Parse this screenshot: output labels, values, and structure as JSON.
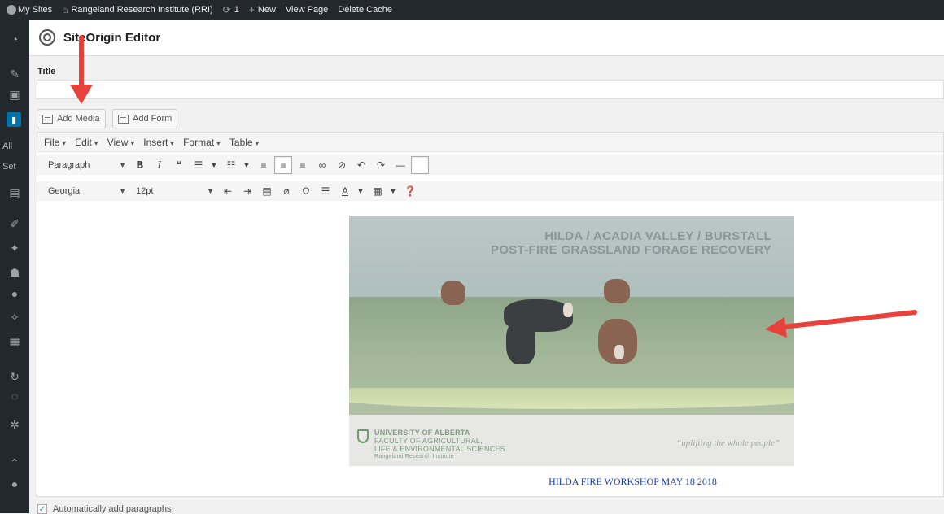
{
  "admin_bar": {
    "my_sites": "My Sites",
    "site_name": "Rangeland Research Institute (RRI)",
    "updates_count": "1",
    "new": "New",
    "view_page": "View Page",
    "delete_cache": "Delete Cache"
  },
  "admin_menu": {
    "sub_all": "All",
    "sub_settings": "Set"
  },
  "editor": {
    "header_title": "SiteOrigin Editor",
    "title_label": "Title",
    "title_value": "",
    "add_media": "Add Media",
    "add_form": "Add Form",
    "menus": [
      "File",
      "Edit",
      "View",
      "Insert",
      "Format",
      "Table"
    ],
    "format_select": "Paragraph",
    "font_select": "Georgia",
    "size_select": "12pt",
    "caption": "HILDA FIRE WORKSHOP MAY 18 2018",
    "autop_label": "Automatically add paragraphs",
    "autop_checked": true
  },
  "slide": {
    "title_line1": "HILDA / ACADIA VALLEY / BURSTALL",
    "title_line2": "POST-FIRE GRASSLAND FORAGE RECOVERY",
    "university": "UNIVERSITY OF ALBERTA",
    "faculty_line1": "FACULTY OF AGRICULTURAL,",
    "faculty_line2": "LIFE & ENVIRONMENTAL SCIENCES",
    "institute": "Rangeland Research Institute",
    "motto": "“uplifting the whole people”"
  },
  "annotation_color": "#e8403a"
}
